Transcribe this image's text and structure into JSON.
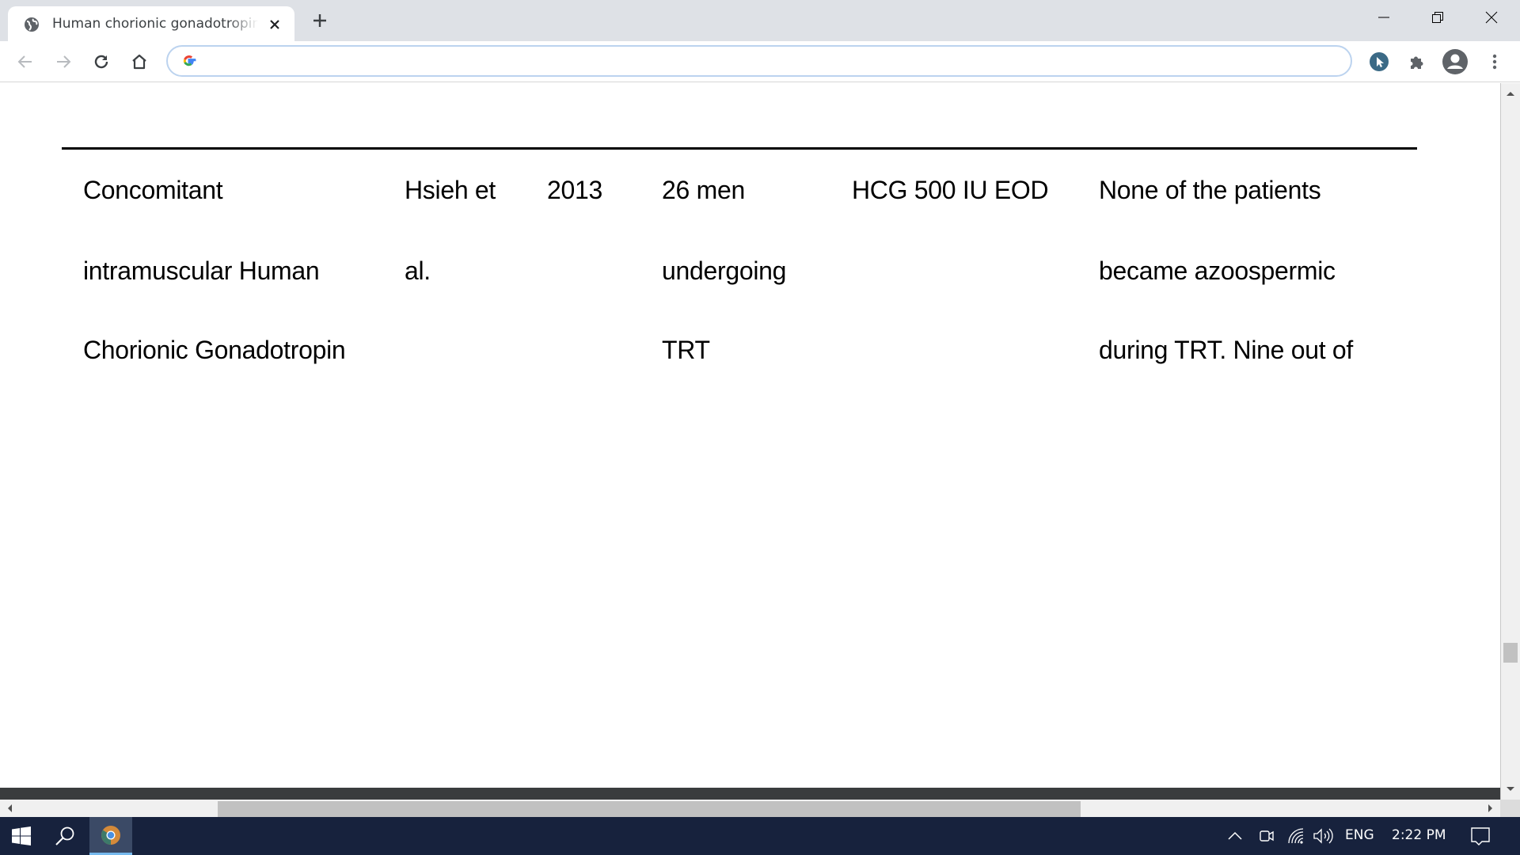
{
  "browser": {
    "tab": {
      "title": "Human chorionic gonadotropin t",
      "favicon": "globe-icon",
      "close_icon": "close-icon"
    },
    "new_tab_icon": "plus-icon",
    "window_controls": [
      "minimize-icon",
      "restore-icon",
      "close-icon"
    ],
    "nav": [
      "back-arrow-icon",
      "forward-arrow-icon",
      "reload-icon",
      "home-icon"
    ],
    "omnibox": {
      "value": "",
      "placeholder": "",
      "icon": "google-g-icon"
    },
    "toolbar_right": [
      "cursor-extension-icon",
      "puzzle-extensions-icon",
      "profile-avatar-icon",
      "kebab-menu-icon"
    ]
  },
  "document": {
    "table": {
      "columns": [
        {
          "key": "intervention",
          "lines": [
            "Concomitant",
            "intramuscular Human",
            "Chorionic Gonadotropin"
          ]
        },
        {
          "key": "author",
          "lines": [
            "Hsieh et",
            "al.",
            ""
          ]
        },
        {
          "key": "year",
          "lines": [
            "2013",
            "",
            ""
          ]
        },
        {
          "key": "population",
          "lines": [
            "26 men",
            "undergoing",
            "TRT"
          ]
        },
        {
          "key": "dose",
          "lines": [
            "HCG 500 IU EOD",
            "",
            ""
          ]
        },
        {
          "key": "outcome",
          "lines": [
            "None of the patients",
            "became azoospermic",
            "during TRT. Nine out of"
          ]
        }
      ]
    }
  },
  "scrollbars": {
    "vertical_position_fraction": 0.82,
    "horizontal_visible_fraction": 0.58
  },
  "taskbar": {
    "left_icons": [
      "windows-start-icon",
      "search-icon",
      "chrome-icon"
    ],
    "tray_icons": [
      "chevron-up-icon",
      "camera-icon",
      "wifi-icon",
      "volume-icon"
    ],
    "language": "ENG",
    "time": "2:22 PM",
    "notification_icon": "action-center-icon"
  }
}
